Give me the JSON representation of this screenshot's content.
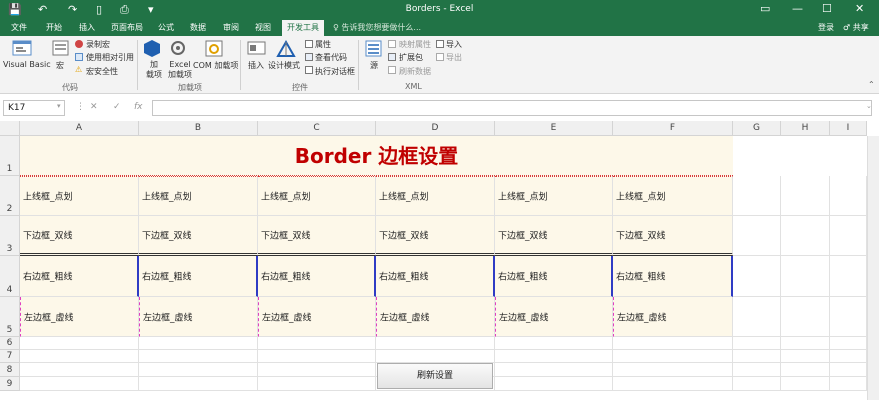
{
  "window": {
    "title": "Borders - Excel",
    "controls": [
      "▭",
      "—",
      "☐",
      "✕"
    ]
  },
  "tabs": [
    {
      "label": "文件"
    },
    {
      "label": "开始"
    },
    {
      "label": "插入"
    },
    {
      "label": "页面布局"
    },
    {
      "label": "公式"
    },
    {
      "label": "数据"
    },
    {
      "label": "审阅"
    },
    {
      "label": "视图"
    },
    {
      "label": "开发工具"
    }
  ],
  "tell_me": "♀ 告诉我您想要做什么...",
  "account": {
    "signin": "登录",
    "share": "♂ 共享"
  },
  "ribbon": {
    "code": {
      "visual_basic": "Visual Basic",
      "macros": "宏",
      "record_macro": "录制宏",
      "relative_ref": "使用相对引用",
      "macro_security": "宏安全性",
      "group": "代码"
    },
    "addins": {
      "addin": "加\n载项",
      "excel_addin": "Excel\n加载项",
      "com_addin": "COM 加载项",
      "group": "加载项"
    },
    "controls": {
      "insert": "插入",
      "design_mode": "设计模式",
      "properties": "属性",
      "view_code": "查看代码",
      "run_dialog": "执行对话框",
      "group": "控件"
    },
    "xml": {
      "source": "源",
      "map_props": "映射属性",
      "expansion": "扩展包",
      "refresh": "刷新数据",
      "import": "导入",
      "export": "导出",
      "group": "XML"
    }
  },
  "formula_bar": {
    "name_box": "K17",
    "cancel": "✕",
    "enter": "✓",
    "fx": "fx",
    "value": ""
  },
  "columns": [
    "A",
    "B",
    "C",
    "D",
    "E",
    "F",
    "G",
    "H",
    "I"
  ],
  "rows": [
    "1",
    "2",
    "3",
    "4",
    "5",
    "6",
    "7",
    "8",
    "9"
  ],
  "sheet": {
    "title": "Border 边框设置",
    "row2": [
      "上线框_点划",
      "上线框_点划",
      "上线框_点划",
      "上线框_点划",
      "上线框_点划",
      "上线框_点划"
    ],
    "row3": [
      "下边框_双线",
      "下边框_双线",
      "下边框_双线",
      "下边框_双线",
      "下边框_双线",
      "下边框_双线"
    ],
    "row4": [
      "右边框_粗线",
      "右边框_粗线",
      "右边框_粗线",
      "右边框_粗线",
      "右边框_粗线",
      "右边框_粗线"
    ],
    "row5": [
      "左边框_虚线",
      "左边框_虚线",
      "左边框_虚线",
      "左边框_虚线",
      "左边框_虚线",
      "左边框_虚线"
    ]
  },
  "button": {
    "label": "刷新设置"
  },
  "colors": {
    "excel_green": "#217346",
    "title_red": "#c00000",
    "shade": "#fdf8e9",
    "thick_border": "#2f3cc4"
  }
}
